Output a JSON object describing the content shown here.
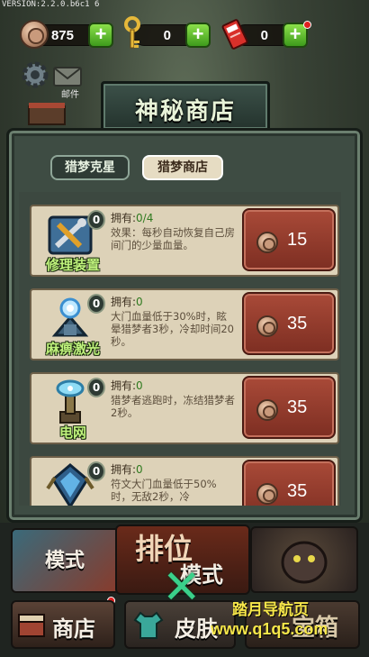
{
  "version": "VERSION:2.2.0.b6c1 6",
  "currencies": {
    "coins": {
      "value": "875",
      "plus": "+"
    },
    "keys": {
      "value": "0",
      "plus": "+"
    },
    "tickets": {
      "value": "0",
      "plus": "+"
    }
  },
  "side_menu": {
    "mail_label": "邮件"
  },
  "title": "神秘商店",
  "tabs": [
    {
      "label": "猎梦克星",
      "active": false
    },
    {
      "label": "猎梦商店",
      "active": true
    }
  ],
  "items": [
    {
      "icon": "wrench-toolbox-icon",
      "badge": "0",
      "name": "修理装置",
      "own_label": "拥有:",
      "own_value": "0/4",
      "desc": "效果：每秒自动恢复自己房间门的少量血量。",
      "price": "15"
    },
    {
      "icon": "laser-turret-icon",
      "badge": "0",
      "name": "麻痹激光",
      "own_label": "拥有:",
      "own_value": "0",
      "desc": "大门血量低于30%时，眩晕猎梦者3秒，冷却时间20秒。",
      "price": "35"
    },
    {
      "icon": "electric-tower-icon",
      "badge": "0",
      "name": "电网",
      "own_label": "拥有:",
      "own_value": "0",
      "desc": "猎梦者逃跑时，冻结猎梦者2秒。",
      "price": "35"
    },
    {
      "icon": "rune-crystal-icon",
      "badge": "0",
      "name": "",
      "own_label": "拥有:",
      "own_value": "0",
      "desc": "符文大门血量低于50%时，无敌2秒，冷",
      "price": "35"
    }
  ],
  "bottom_menu": {
    "mode_label": "模式",
    "rank_label": "排位",
    "rank_sub": "模式",
    "shop_label": "商店",
    "skin_label": "皮肤",
    "chest_label": "宝箱"
  },
  "close_symbol": "✕",
  "watermark": {
    "line1": "踏月导航页",
    "line2": "www.q1q5.com"
  }
}
